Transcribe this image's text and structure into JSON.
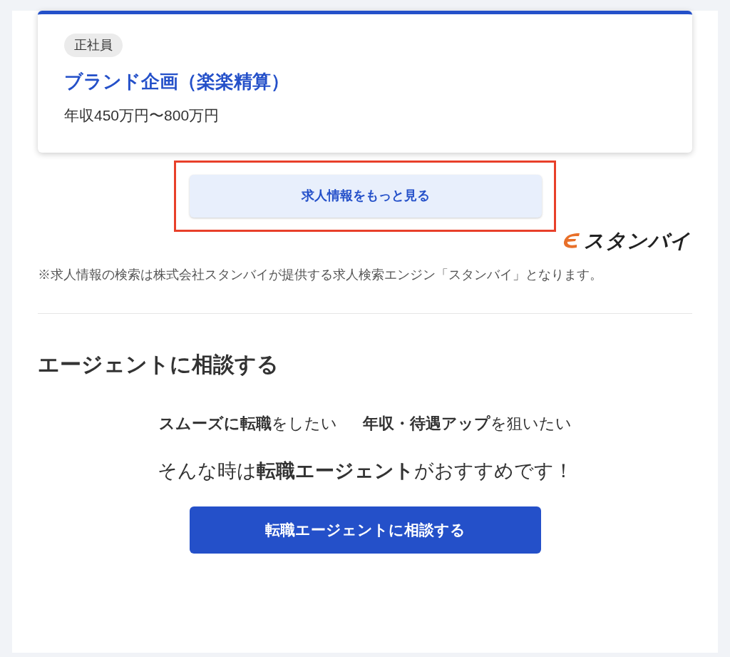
{
  "job_card": {
    "tag": "正社員",
    "title": "ブランド企画（楽楽精算）",
    "salary": "年収450万円〜800万円"
  },
  "more_button": {
    "label": "求人情報をもっと見る",
    "highlighted": true
  },
  "logo": {
    "text": "スタンバイ"
  },
  "note": "※求人情報の検索は株式会社スタンバイが提供する求人検索エンジン「スタンバイ」となります。",
  "agent_section": {
    "heading": "エージェントに相談する",
    "phrases": [
      "**スムーズに転職**をしたい",
      "**年収・待遇アップ**を狙いたい"
    ],
    "lead": "そんな時は**転職エージェント**がおすすめです！",
    "button": "転職エージェントに相談する"
  }
}
